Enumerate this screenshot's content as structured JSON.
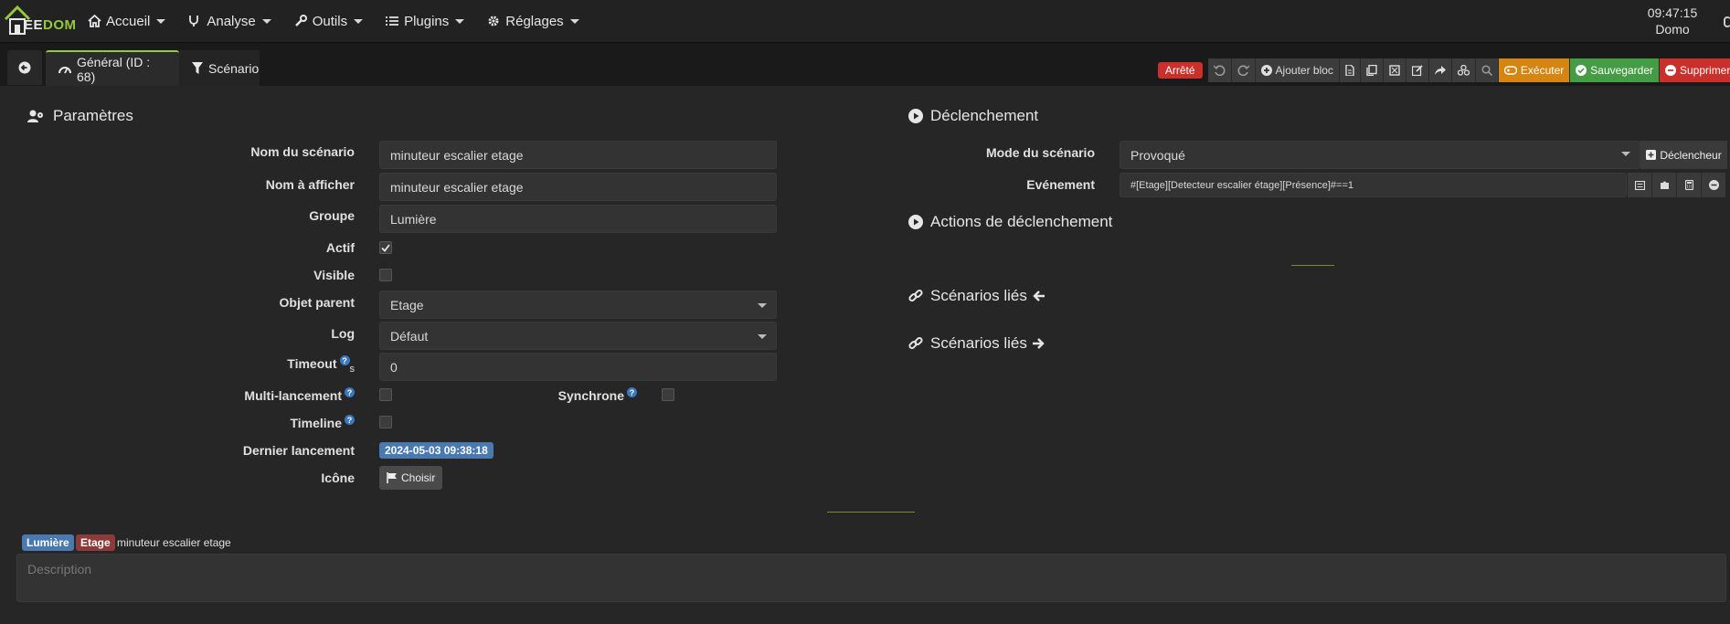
{
  "navbar": {
    "logo_text_e": "EE",
    "logo_text_dom": "DOM",
    "menu": [
      {
        "label": "Accueil",
        "icon": "home-icon"
      },
      {
        "label": "Analyse",
        "icon": "stethoscope-icon"
      },
      {
        "label": "Outils",
        "icon": "wrench-icon"
      },
      {
        "label": "Plugins",
        "icon": "list-icon"
      },
      {
        "label": "Réglages",
        "icon": "gear-icon"
      }
    ],
    "time": "09:47:15",
    "user": "Domo"
  },
  "tabs": {
    "general": "Général (ID : 68)",
    "scenario": "Scénario"
  },
  "toolbar": {
    "status": "Arrêté",
    "add_block": "Ajouter bloc",
    "execute": "Exécuter",
    "save": "Sauvegarder",
    "delete": "Supprimer"
  },
  "params": {
    "title": "Paramètres",
    "name_label": "Nom du scénario",
    "name_value": "minuteur escalier etage",
    "display_label": "Nom à afficher",
    "display_value": "minuteur escalier etage",
    "group_label": "Groupe",
    "group_value": "Lumière",
    "active_label": "Actif",
    "visible_label": "Visible",
    "parent_label": "Objet parent",
    "parent_value": "Etage",
    "log_label": "Log",
    "log_value": "Défaut",
    "timeout_label": "Timeout",
    "timeout_unit": "s",
    "timeout_value": "0",
    "multi_label": "Multi-lancement",
    "sync_label": "Synchrone",
    "timeline_label": "Timeline",
    "last_run_label": "Dernier lancement",
    "last_run_value": "2024-05-03 09:38:18",
    "icon_label": "Icône",
    "choose_label": "Choisir",
    "help_glyph": "?"
  },
  "trigger": {
    "title": "Déclenchement",
    "mode_label": "Mode du scénario",
    "mode_value": "Provoqué",
    "trigger_button": "Déclencheur",
    "event_label": "Evénement",
    "event_value": "#[Etage][Detecteur escalier étage][Présence]#==1",
    "actions_title": "Actions de déclenchement",
    "linked_in": "Scénarios liés",
    "linked_out": "Scénarios liés"
  },
  "footer": {
    "tag_group": "Lumière",
    "tag_object": "Etage",
    "scenario_name": "minuteur escalier etage",
    "description_placeholder": "Description"
  },
  "colors": {
    "accent": "#94c93d",
    "danger": "#c9302c",
    "warning": "#d58512",
    "success": "#449d44",
    "info": "#4a79b0"
  }
}
